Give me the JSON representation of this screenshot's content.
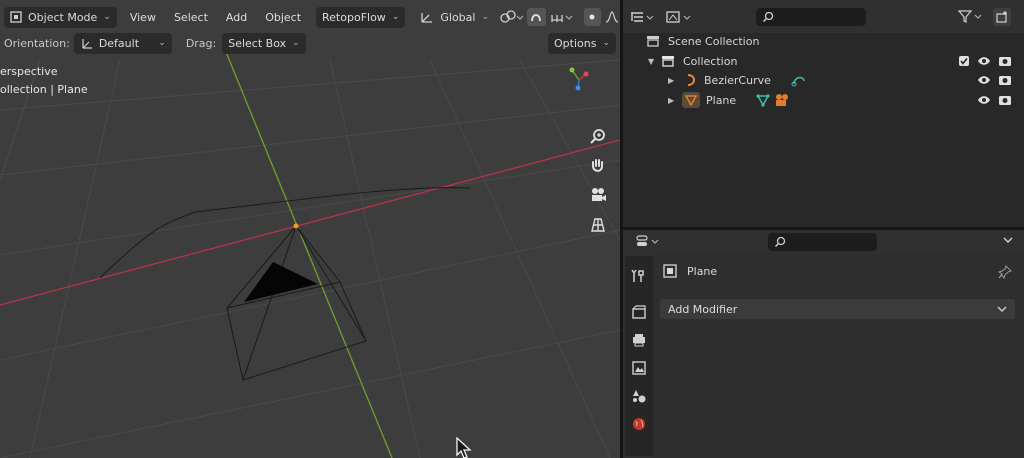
{
  "viewport_header": {
    "mode_label": "Object Mode",
    "menus": [
      "View",
      "Select",
      "Add",
      "Object"
    ],
    "addon_menu": "RetopoFlow",
    "transform_orientation": "Global"
  },
  "tool_settings": {
    "orientation_label": "Orientation:",
    "orientation_value": "Default",
    "drag_label": "Drag:",
    "drag_value": "Select Box",
    "options_label": "Options"
  },
  "viewport_overlay": {
    "view_name": "erspective",
    "collection_info": "ollection | Plane"
  },
  "nav_gizmo_icons": [
    "zoom-icon",
    "hand-pan-icon",
    "camera-icon",
    "grid-view-icon"
  ],
  "outliner": {
    "search_placeholder": "",
    "scene_collection": "Scene Collection",
    "collection": "Collection",
    "items": [
      {
        "name": "BezierCurve",
        "type": "curve"
      },
      {
        "name": "Plane",
        "type": "mesh"
      }
    ]
  },
  "properties": {
    "search_placeholder": "",
    "object_name": "Plane",
    "add_modifier_label": "Add Modifier"
  },
  "colors": {
    "viewport_bg": "#3d3d3d",
    "x_axis": "#b8334a",
    "y_axis": "#6fa02a",
    "curve_orange": "#e8863a",
    "data_green": "#3dbdb0",
    "object_orange": "#e07d2f"
  }
}
